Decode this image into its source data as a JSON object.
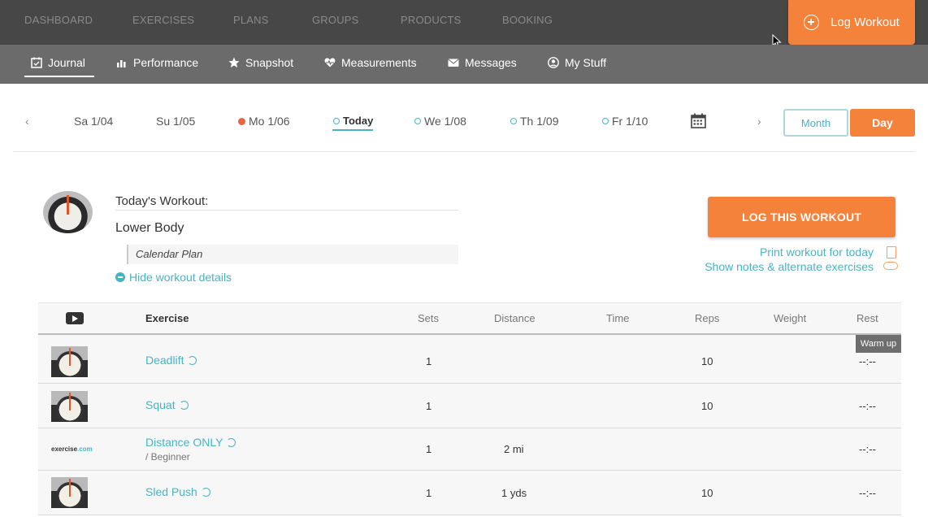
{
  "topnav": {
    "items": [
      "DASHBOARD",
      "EXERCISES",
      "PLANS",
      "GROUPS",
      "PRODUCTS",
      "BOOKING"
    ],
    "log_workout": "Log Workout"
  },
  "subnav": {
    "items": [
      {
        "label": "Journal",
        "icon": "calendar-check-icon"
      },
      {
        "label": "Performance",
        "icon": "bar-chart-icon"
      },
      {
        "label": "Snapshot",
        "icon": "star-icon"
      },
      {
        "label": "Measurements",
        "icon": "heart-pulse-icon"
      },
      {
        "label": "Messages",
        "icon": "envelope-icon"
      },
      {
        "label": "My Stuff",
        "icon": "user-circle-icon"
      }
    ],
    "active": "Journal"
  },
  "datebar": {
    "dates": [
      "Sa 1/04",
      "Su 1/05",
      "Mo 1/06",
      "Today",
      "We 1/08",
      "Th 1/09",
      "Fr 1/10"
    ],
    "month_label": "Month",
    "day_label": "Day"
  },
  "workout": {
    "title_label": "Today's Workout:",
    "name": "Lower Body",
    "plan": "Calendar Plan",
    "hide_details": "Hide workout details",
    "log_button": "LOG THIS WORKOUT",
    "print_link": "Print workout for today",
    "notes_link": "Show notes & alternate exercises"
  },
  "table": {
    "headers": {
      "exercise": "Exercise",
      "sets": "Sets",
      "distance": "Distance",
      "time": "Time",
      "reps": "Reps",
      "weight": "Weight",
      "rest": "Rest"
    },
    "warmup_label": "Warm up",
    "rows": [
      {
        "name": "Deadlift",
        "sub": "",
        "sets": "1",
        "distance": "",
        "time": "",
        "reps": "10",
        "weight": "",
        "rest": "--:--"
      },
      {
        "name": "Squat",
        "sub": "",
        "sets": "1",
        "distance": "",
        "time": "",
        "reps": "10",
        "weight": "",
        "rest": "--:--"
      },
      {
        "name": "Distance ONLY",
        "sub": "/ Beginner",
        "sets": "1",
        "distance": "2 mi",
        "time": "",
        "reps": "",
        "weight": "",
        "rest": "--:--"
      },
      {
        "name": "Sled Push",
        "sub": "",
        "sets": "1",
        "distance": "1 yds",
        "time": "",
        "reps": "10",
        "weight": "",
        "rest": "--:--"
      }
    ],
    "logo_text_a": "exercise",
    "logo_text_b": ".com"
  },
  "colors": {
    "accent": "#f5823b",
    "link": "#4ab3c3",
    "topnav_bg": "#474747",
    "subnav_bg": "#6b6b6b"
  }
}
